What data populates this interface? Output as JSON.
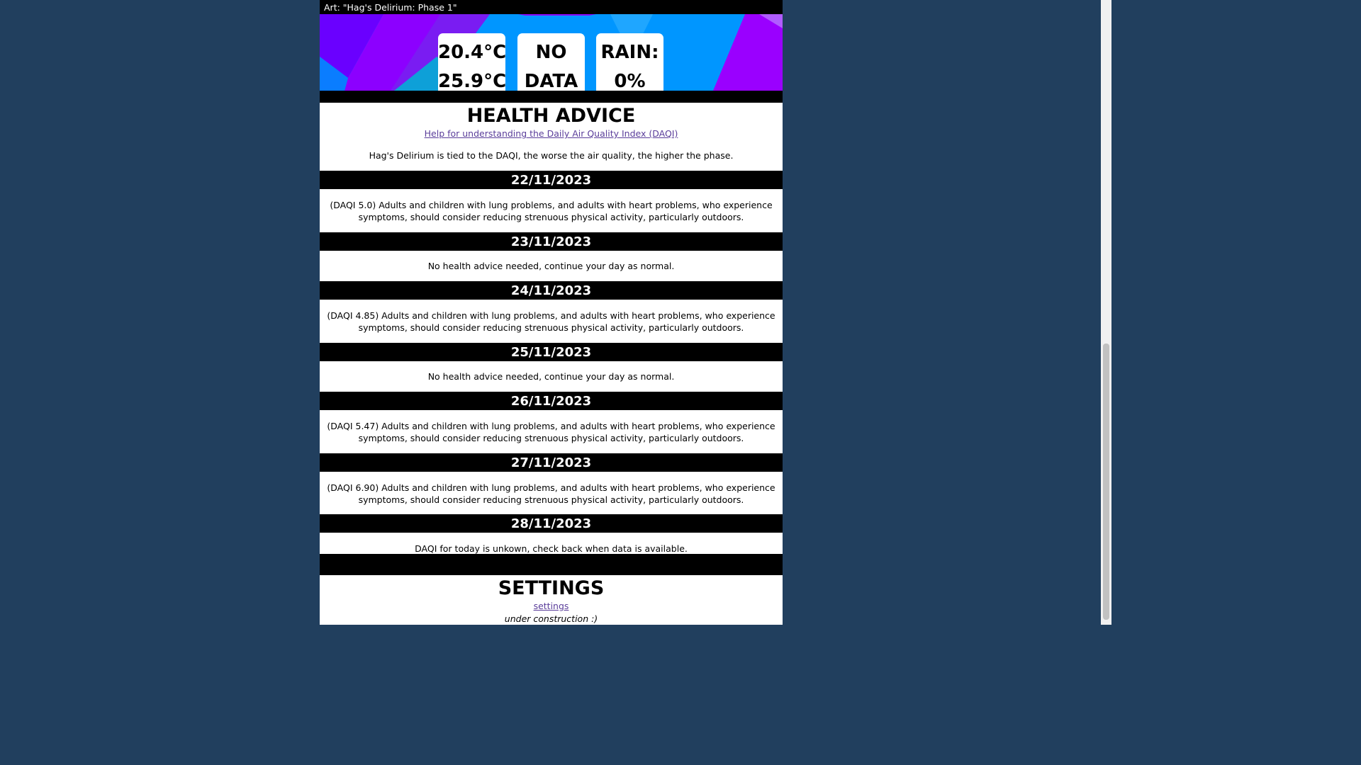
{
  "art": {
    "label": "Art: \"Hag's Delirium: Phase 1\""
  },
  "weather": {
    "temp_low": "20.4°C",
    "temp_high": "25.9°C",
    "aq_line1": "NO",
    "aq_line2": "DATA",
    "rain_line1": "RAIN:",
    "rain_line2": "0%"
  },
  "health": {
    "title": "HEALTH ADVICE",
    "help_link": "Help for understanding the Daily Air Quality Index (DAQI)",
    "description": "Hag's Delirium is tied to the DAQI, the worse the air quality, the higher the phase.",
    "days": [
      {
        "date": "22/11/2023",
        "advice": "(DAQI 5.0) Adults and children with lung problems, and adults with heart problems, who experience symptoms, should consider reducing strenuous physical activity, particularly outdoors."
      },
      {
        "date": "23/11/2023",
        "advice": "No health advice needed, continue your day as normal."
      },
      {
        "date": "24/11/2023",
        "advice": "(DAQI 4.85) Adults and children with lung problems, and adults with heart problems, who experience symptoms, should consider reducing strenuous physical activity, particularly outdoors."
      },
      {
        "date": "25/11/2023",
        "advice": "No health advice needed, continue your day as normal."
      },
      {
        "date": "26/11/2023",
        "advice": "(DAQI 5.47) Adults and children with lung problems, and adults with heart problems, who experience symptoms, should consider reducing strenuous physical activity, particularly outdoors."
      },
      {
        "date": "27/11/2023",
        "advice": "(DAQI 6.90) Adults and children with lung problems, and adults with heart problems, who experience symptoms, should consider reducing strenuous physical activity, particularly outdoors."
      },
      {
        "date": "28/11/2023",
        "advice": "DAQI for today is unkown, check back when data is available."
      }
    ]
  },
  "settings": {
    "title": "SETTINGS",
    "link": "settings",
    "note": "under construction :)"
  },
  "colors": {
    "background": "#213f5e",
    "art_blue": "#0096ff",
    "art_purple": "#8c00ff"
  }
}
